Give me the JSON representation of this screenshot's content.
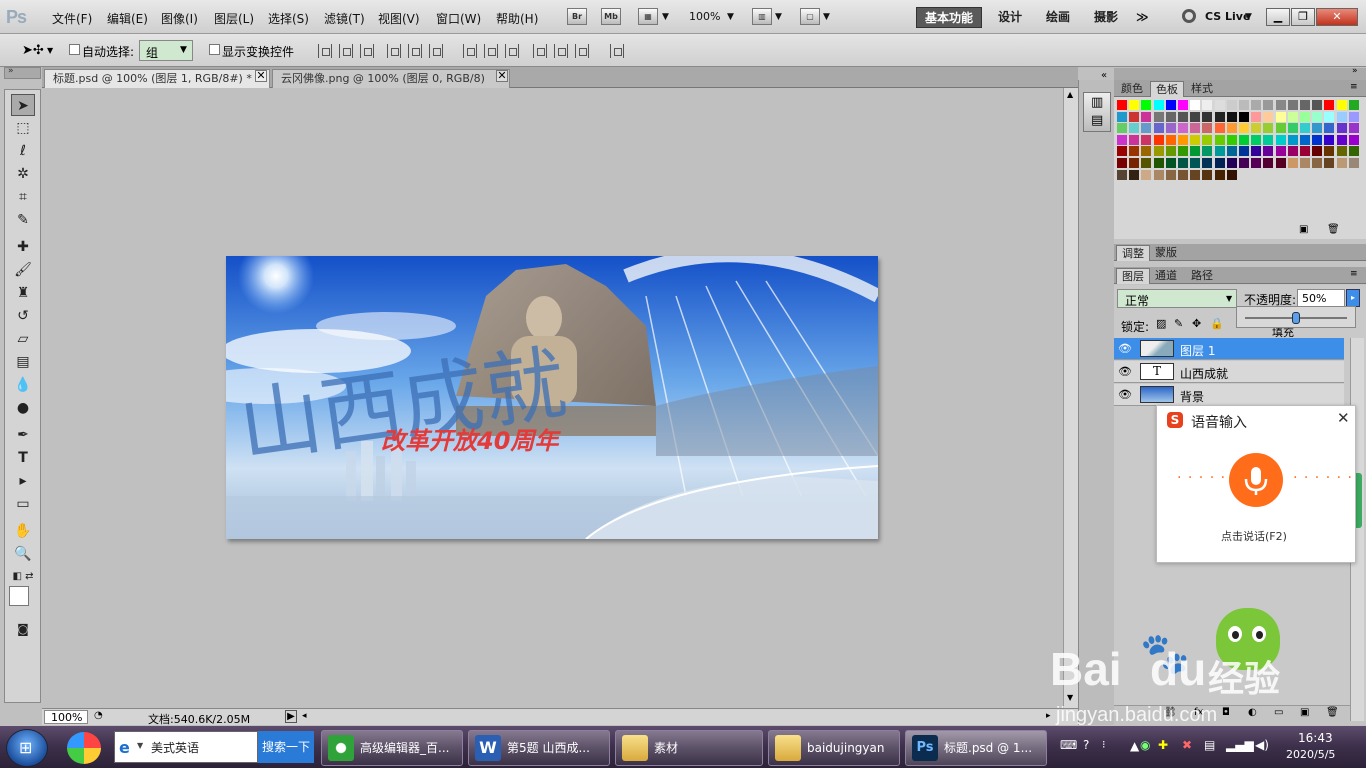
{
  "app": {
    "logo": "Ps"
  },
  "menu": [
    "文件(F)",
    "编辑(E)",
    "图像(I)",
    "图层(L)",
    "选择(S)",
    "滤镜(T)",
    "视图(V)",
    "窗口(W)",
    "帮助(H)"
  ],
  "appbar": {
    "bridge": "Br",
    "minibridge": "Mb",
    "zoom": "100%"
  },
  "workspaces": [
    "基本功能",
    "设计",
    "绘画",
    "摄影"
  ],
  "cslive": "CS Live",
  "options": {
    "auto_select_label": "自动选择:",
    "auto_select_value": "组",
    "show_transform_label": "显示变换控件"
  },
  "doc_tabs": [
    {
      "label": "标题.psd @ 100% (图层 1, RGB/8#) *",
      "active": true
    },
    {
      "label": "云冈佛像.png @ 100% (图层 0, RGB/8)",
      "active": false
    }
  ],
  "artwork": {
    "title": "山西成就",
    "subtitle": "改革开放40周年"
  },
  "status": {
    "zoom": "100%",
    "doc": "文档:540.6K/2.05M"
  },
  "swatch_panel": {
    "tabs": [
      "颜色",
      "色板",
      "样式"
    ],
    "active": "色板"
  },
  "adjust_panel": {
    "tabs": [
      "调整",
      "蒙版"
    ]
  },
  "layers_panel": {
    "tabs": [
      "图层",
      "通道",
      "路径"
    ],
    "blend_mode": "正常",
    "opacity_label": "不透明度:",
    "opacity_value": "50%",
    "opacity_fraction": 0.5,
    "lock_label": "锁定:",
    "fill_label": "填充",
    "layers": [
      {
        "name": "图层 1",
        "selected": true,
        "thumb": "image"
      },
      {
        "name": "山西成就",
        "selected": false,
        "thumb": "text"
      },
      {
        "name": "背景",
        "selected": false,
        "thumb": "sky"
      }
    ]
  },
  "voice_input": {
    "title": "语音输入",
    "logo": "S",
    "action": "点击说话(F2)"
  },
  "taskbar": {
    "search_value": "美式英语",
    "search_button": "搜索一下",
    "tasks": [
      "高级编辑器_百...",
      "第5题 山西成...",
      "素材",
      "baidujingyan",
      "标题.psd @ 1..."
    ],
    "time": "16:43",
    "date": "2020/5/5"
  },
  "watermark": {
    "brand": "Bai",
    "brand2": "du",
    "cn": "经验",
    "url": "jingyan.baidu.com"
  },
  "colors": {
    "accent": "#3d8ee9",
    "voice_orange": "#ff6d1a",
    "sogou": "#e8411e"
  }
}
